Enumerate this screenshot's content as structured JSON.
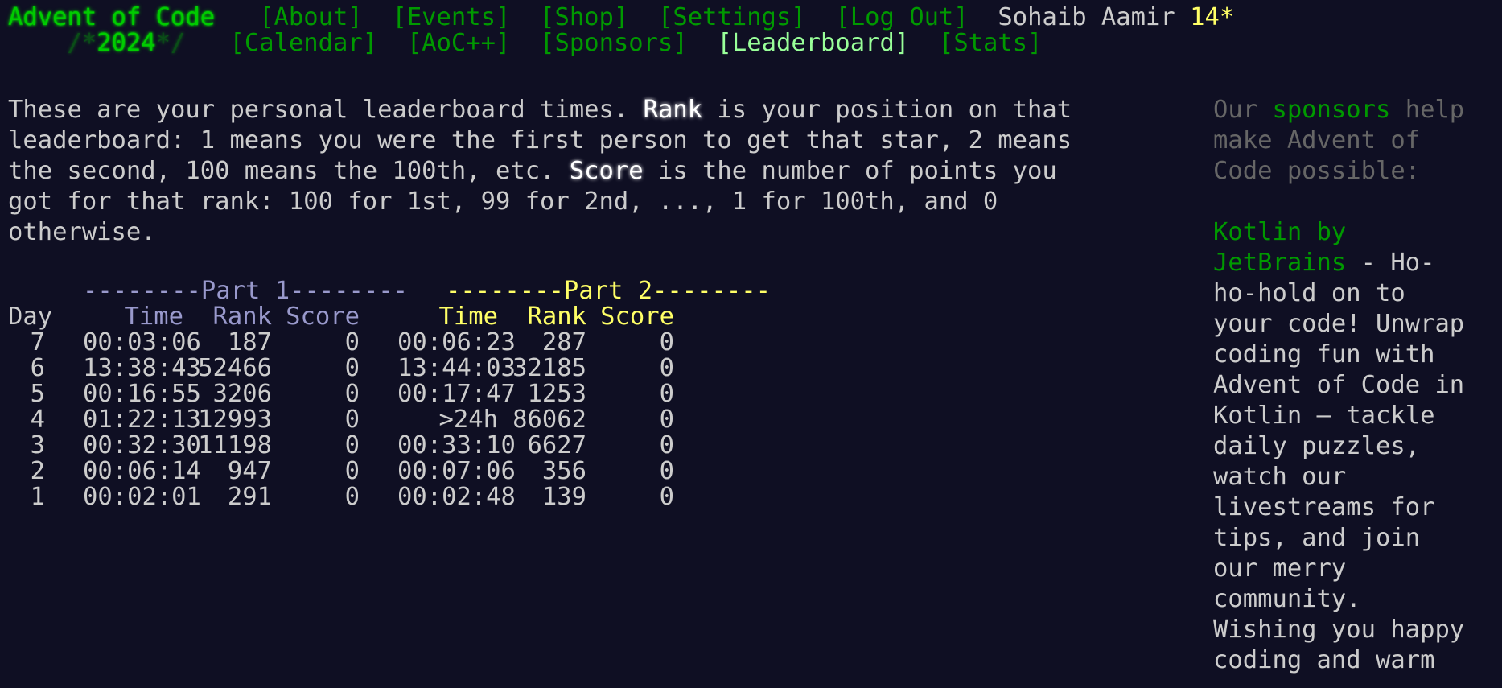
{
  "header": {
    "title": "Advent of Code",
    "nav_top": [
      "[About]",
      "[Events]",
      "[Shop]",
      "[Settings]",
      "[Log Out]"
    ],
    "user_name": "Sohaib Aamir",
    "stars": "14*",
    "year_prefix": "/*",
    "year": "2024",
    "year_suffix": "*/",
    "nav_bottom": [
      "[Calendar]",
      "[AoC++]",
      "[Sponsors]",
      "[Leaderboard]",
      "[Stats]"
    ]
  },
  "intro": {
    "p1": "These are your personal leaderboard times. ",
    "rank_word": "Rank",
    "p2": " is your position on that\nleaderboard: 1 means you were the first person to get that star, 2 means\nthe second, 100 means the 100th, etc. ",
    "score_word": "Score",
    "p3": " is the number of points you\ngot for that rank: 100 for 1st, 99 for 2nd, ..., 1 for 100th, and 0\notherwise."
  },
  "table": {
    "part1_header": "--------Part 1--------",
    "part2_header": "--------Part 2--------",
    "col_day": "Day",
    "col_time": "Time",
    "col_rank": "Rank",
    "col_score": "Score",
    "rows": [
      {
        "day": "7",
        "t1": "00:03:06",
        "r1": "187",
        "s1": "0",
        "t2": "00:06:23",
        "r2": "287",
        "s2": "0"
      },
      {
        "day": "6",
        "t1": "13:38:43",
        "r1": "52466",
        "s1": "0",
        "t2": "13:44:03",
        "r2": "32185",
        "s2": "0"
      },
      {
        "day": "5",
        "t1": "00:16:55",
        "r1": "3206",
        "s1": "0",
        "t2": "00:17:47",
        "r2": "1253",
        "s2": "0"
      },
      {
        "day": "4",
        "t1": "01:22:13",
        "r1": "12993",
        "s1": "0",
        "t2": ">24h",
        "r2": "86062",
        "s2": "0"
      },
      {
        "day": "3",
        "t1": "00:32:30",
        "r1": "11198",
        "s1": "0",
        "t2": "00:33:10",
        "r2": "6627",
        "s2": "0"
      },
      {
        "day": "2",
        "t1": "00:06:14",
        "r1": "947",
        "s1": "0",
        "t2": "00:07:06",
        "r2": "356",
        "s2": "0"
      },
      {
        "day": "1",
        "t1": "00:02:01",
        "r1": "291",
        "s1": "0",
        "t2": "00:02:48",
        "r2": "139",
        "s2": "0"
      }
    ]
  },
  "sidebar": {
    "intro_a": "Our ",
    "intro_link": "sponsors",
    "intro_b": " help\nmake Advent of\nCode possible:",
    "sponsor_name": "Kotlin by\nJetBrains",
    "sponsor_text_first": " - Ho-",
    "sponsor_text_rest": "ho-hold on to\nyour code! Unwrap\ncoding fun with\nAdvent of Code in\nKotlin – tackle\ndaily puzzles,\nwatch our\nlivestreams for\ntips, and join\nour merry\ncommunity.\nWishing you happy\ncoding and warm"
  },
  "colors": {
    "background": "#0f0f23",
    "text": "#cccccc",
    "link_green": "#009900",
    "bright_green": "#00cc00",
    "active_link": "#99ff99",
    "gold": "#ffff66",
    "part1": "#9999cc"
  }
}
